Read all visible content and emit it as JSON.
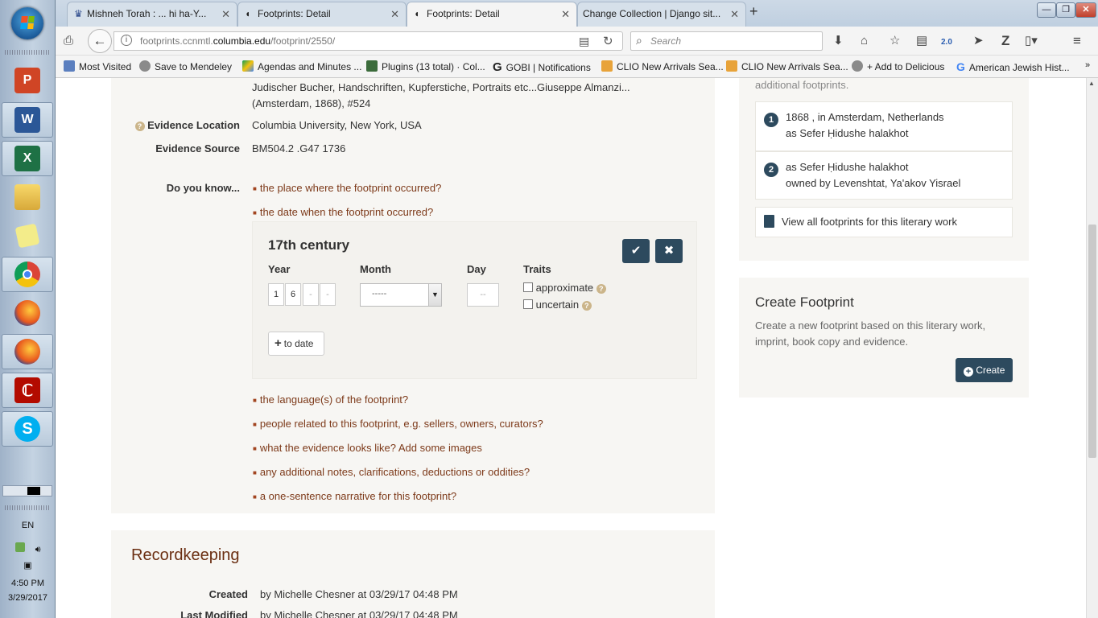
{
  "taskbar": {
    "language": "EN",
    "time": "4:50 PM",
    "date": "3/29/2017"
  },
  "tabs": [
    {
      "label": "Mishneh Torah : ... hi ha-Y...",
      "icon": "crown-icon"
    },
    {
      "label": "Footprints: Detail",
      "icon": "footprint-icon"
    },
    {
      "label": "Footprints: Detail",
      "icon": "footprint-icon",
      "active": true
    },
    {
      "label": "Change Collection | Django sit...",
      "icon": "none"
    }
  ],
  "nav": {
    "url_host_prefix": "footprints.ccnmtl.",
    "url_host_main": "columbia.edu",
    "url_path": "/footprint/2550/",
    "search_placeholder": "Search",
    "gbs_label": "2.0"
  },
  "bookmarks": [
    {
      "label": "Most Visited"
    },
    {
      "label": "Save to Mendeley"
    },
    {
      "label": "Agendas and Minutes ..."
    },
    {
      "label": "Plugins (13 total) · Col..."
    },
    {
      "label": "GOBI | Notifications"
    },
    {
      "label": "CLIO New Arrivals Sea..."
    },
    {
      "label": "CLIO New Arrivals Sea..."
    },
    {
      "label": "+ Add to Delicious"
    },
    {
      "label": "American Jewish Hist..."
    }
  ],
  "detail": {
    "citation_line1": "Judischer Bucher, Handschriften, Kupferstiche, Portraits etc...Giuseppe Almanzi...",
    "citation_line2": "(Amsterdam, 1868), #524",
    "evidence_location_label": "Evidence Location",
    "evidence_location": "Columbia University, New York, USA",
    "evidence_source_label": "Evidence Source",
    "evidence_source": "BM504.2 .G47 1736",
    "do_you_know_label": "Do you know...",
    "questions_top": [
      "the place where the footprint occurred?",
      "the date when the footprint occurred?"
    ],
    "questions_bottom": [
      "the language(s) of the footprint?",
      "people related to this footprint, e.g. sellers, owners, curators?",
      "what the evidence looks like? Add some images",
      "any additional notes, clarifications, deductions or oddities?",
      "a one-sentence narrative for this footprint?"
    ]
  },
  "date_editor": {
    "title": "17th century",
    "year_label": "Year",
    "month_label": "Month",
    "day_label": "Day",
    "traits_label": "Traits",
    "year_digits": [
      "1",
      "6",
      "-",
      "-"
    ],
    "month_value": "-----",
    "day_value": "--",
    "trait_approximate": "approximate",
    "trait_uncertain": "uncertain",
    "to_date_label": "to date"
  },
  "sidebar": {
    "intro_text": "additional footprints.",
    "footprints": [
      {
        "number": "1",
        "line1": "1868 , in Amsterdam, Netherlands",
        "line2": "as Sefer Ḥidushe halakhot"
      },
      {
        "number": "2",
        "line1": "as Sefer Ḥidushe halakhot",
        "line2": "owned by Levenshtat, Ya'akov Yisrael"
      }
    ],
    "view_all_label": "View all footprints for this literary work",
    "create_title": "Create Footprint",
    "create_line1": "Create a new footprint based on this literary work,",
    "create_line2": "imprint, book copy and evidence.",
    "create_button": "Create"
  },
  "recordkeeping": {
    "heading": "Recordkeeping",
    "created_label": "Created",
    "created_value": "by Michelle Chesner at 03/29/17 04:48 PM",
    "modified_label": "Last Modified",
    "modified_value": "by Michelle Chesner at 03/29/17 04:48 PM"
  }
}
